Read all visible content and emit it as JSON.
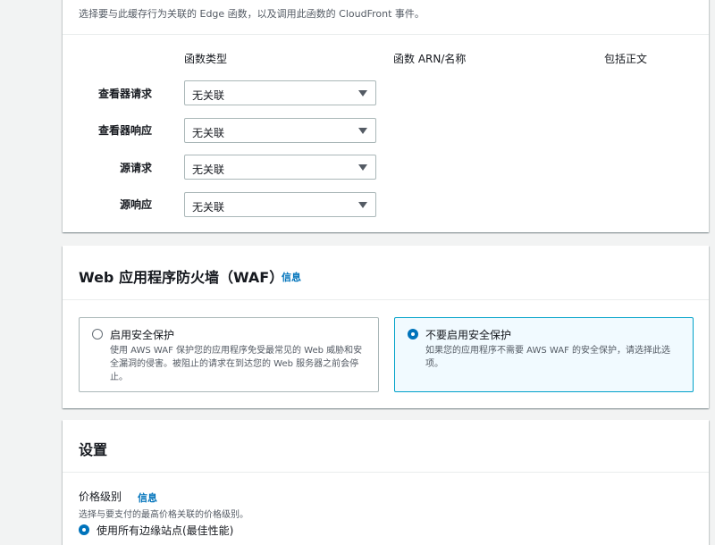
{
  "functions_panel": {
    "description": "选择要与此缓存行为关联的 Edge 函数，以及调用此函数的 CloudFront 事件。",
    "columns": {
      "function_type": "函数类型",
      "function_arn": "函数 ARN/名称",
      "include_body": "包括正文"
    },
    "rows": [
      {
        "label": "查看器请求",
        "value": "无关联"
      },
      {
        "label": "查看器响应",
        "value": "无关联"
      },
      {
        "label": "源请求",
        "value": "无关联"
      },
      {
        "label": "源响应",
        "value": "无关联"
      }
    ]
  },
  "waf_panel": {
    "title": "Web 应用程序防火墙（WAF）",
    "info_link": "信息",
    "options": [
      {
        "title": "启用安全保护",
        "description": "使用 AWS WAF 保护您的应用程序免受最常见的 Web 威胁和安全漏洞的侵害。被阻止的请求在到达您的 Web 服务器之前会停止。",
        "selected": false
      },
      {
        "title": "不要启用安全保护",
        "description": "如果您的应用程序不需要 AWS WAF 的安全保护，请选择此选项。",
        "selected": true
      }
    ]
  },
  "settings_panel": {
    "title": "设置",
    "price_class": {
      "label": "价格级别",
      "info_link": "信息",
      "description": "选择与要支付的最高价格关联的价格级别。",
      "selected_option": "使用所有边缘站点(最佳性能)"
    }
  },
  "colors": {
    "page_background": "#f2f3f3",
    "link": "#0073bb",
    "selected_border": "#00a1c9",
    "selected_background": "#f1faff"
  }
}
